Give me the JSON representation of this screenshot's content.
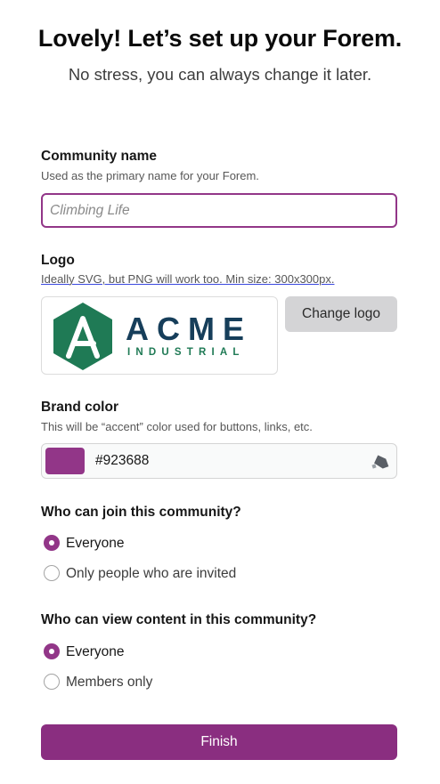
{
  "header": {
    "title": "Lovely! Let’s set up your Forem.",
    "subtitle": "No stress, you can always change it later."
  },
  "community_name": {
    "label": "Community name",
    "hint": "Used as the primary name for your Forem.",
    "placeholder": "Climbing Life",
    "value": ""
  },
  "logo": {
    "label": "Logo",
    "hint": "Ideally SVG, but PNG will work too. Min size: 300x300px.",
    "brand_main": "ACME",
    "brand_sub": "INDUSTRIAL",
    "change_label": "Change logo"
  },
  "brand_color": {
    "label": "Brand color",
    "hint": "This will be “accent” color used for buttons, links, etc.",
    "value": "#923688"
  },
  "join": {
    "question": "Who can join this community?",
    "options": [
      {
        "label": "Everyone",
        "checked": true
      },
      {
        "label": "Only people who are invited",
        "checked": false
      }
    ]
  },
  "view": {
    "question": "Who can view content in this community?",
    "options": [
      {
        "label": "Everyone",
        "checked": true
      },
      {
        "label": "Members only",
        "checked": false
      }
    ]
  },
  "finish_label": "Finish",
  "colors": {
    "accent": "#923688",
    "logo_green": "#1f7a55",
    "logo_navy": "#163e5a"
  }
}
